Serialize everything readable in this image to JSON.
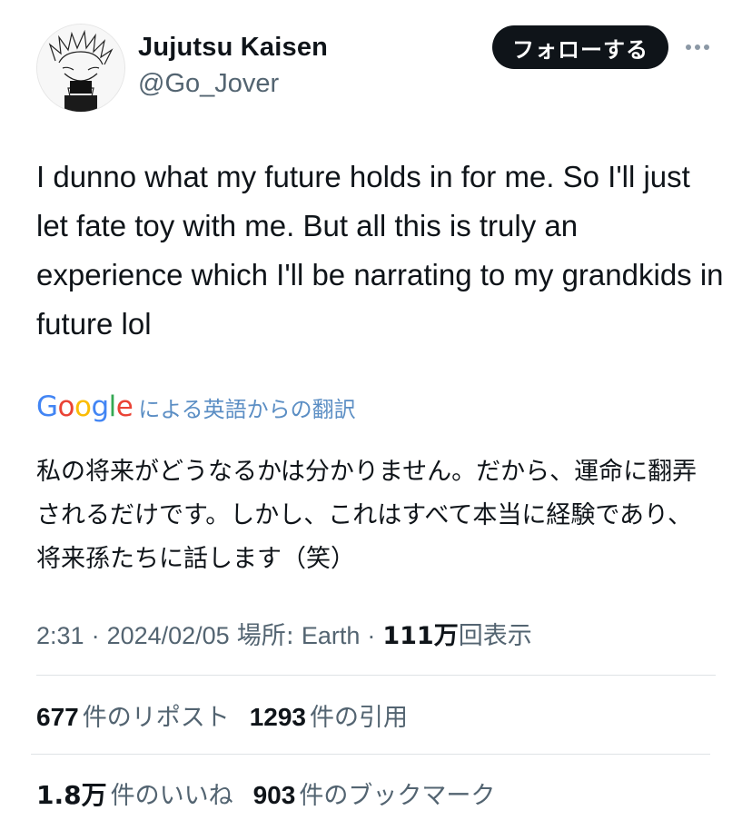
{
  "header": {
    "display_name": "Jujutsu Kaisen",
    "handle": "@Go_Jover",
    "follow_label": "フォローする",
    "more_icon": "more-horizontal-icon"
  },
  "tweet": {
    "text": "I dunno what my future holds in for me. So I'll just let fate toy with me. But all this is truly an experience which I'll be narrating to my grandkids in future lol"
  },
  "translation": {
    "brand": "Google",
    "brand_colors": [
      "#4285F4",
      "#EA4335",
      "#FBBC05",
      "#4285F4",
      "#34A853",
      "#EA4335"
    ],
    "label": "による英語からの翻訳",
    "text": "私の将来がどうなるかは分かりません。だから、運命に翻弄されるだけです。しかし、これはすべて本当に経験であり、将来孫たちに話します（笑）"
  },
  "meta": {
    "time": "2:31",
    "sep1": "·",
    "date": "2024/02/05",
    "location_label": "場所:",
    "location": "Earth",
    "sep2": "·",
    "views_count": "111万",
    "views_label": "回表示"
  },
  "stats": {
    "reposts_count": "677",
    "reposts_label": "件のリポスト",
    "quotes_count": "1293",
    "quotes_label": "件の引用",
    "likes_count": "1.8万",
    "likes_label": "件のいいね",
    "bookmarks_count": "903",
    "bookmarks_label": "件のブックマーク"
  }
}
